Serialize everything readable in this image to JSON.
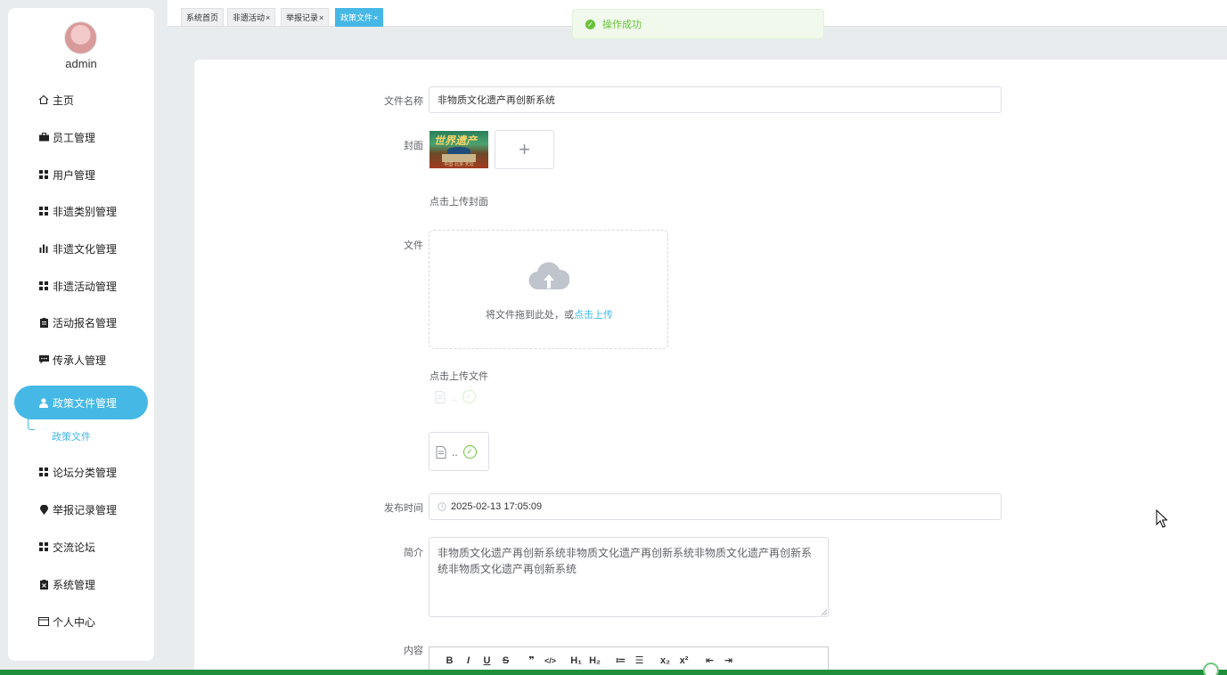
{
  "user": {
    "name": "admin"
  },
  "sidebar": {
    "items": [
      {
        "label": "主页",
        "icon": "home-icon"
      },
      {
        "label": "员工管理",
        "icon": "briefcase-icon"
      },
      {
        "label": "用户管理",
        "icon": "grid-icon"
      },
      {
        "label": "非遗类别管理",
        "icon": "grid-icon"
      },
      {
        "label": "非遗文化管理",
        "icon": "bar-chart-icon"
      },
      {
        "label": "非遗活动管理",
        "icon": "grid-icon"
      },
      {
        "label": "活动报名管理",
        "icon": "clipboard-icon"
      },
      {
        "label": "传承人管理",
        "icon": "message-icon"
      },
      {
        "label": "政策文件管理",
        "icon": "user-icon"
      },
      {
        "label": "论坛分类管理",
        "icon": "grid-icon"
      },
      {
        "label": "举报记录管理",
        "icon": "map-pin-icon"
      },
      {
        "label": "交流论坛",
        "icon": "grid-icon"
      },
      {
        "label": "系统管理",
        "icon": "clipboard-x-icon"
      },
      {
        "label": "个人中心",
        "icon": "card-icon"
      }
    ],
    "active_index": 8,
    "sub_item": "政策文件"
  },
  "tabs": [
    {
      "label": "系统首页",
      "closable": false
    },
    {
      "label": "非遗活动",
      "closable": true
    },
    {
      "label": "举报记录",
      "closable": true
    },
    {
      "label": "政策文件",
      "closable": true,
      "active": true
    }
  ],
  "toast": {
    "message": "操作成功"
  },
  "form": {
    "file_name": {
      "label": "文件名称",
      "value": "非物质文化遗产再创新系统"
    },
    "cover": {
      "label": "封面",
      "thumb_title": "世界遗产",
      "thumb_caption": "中国·北京·天坛",
      "hint": "点击上传封面",
      "add_symbol": "+"
    },
    "file": {
      "label": "文件",
      "drop_text": "将文件拖到此处，或",
      "drop_link": "点击上传",
      "hint": "点击上传文件",
      "file_name_short": ".."
    },
    "publish_time": {
      "label": "发布时间",
      "value": "2025-02-13 17:05:09"
    },
    "intro": {
      "label": "简介",
      "value": "非物质文化遗产再创新系统非物质文化遗产再创新系统非物质文化遗产再创新系统非物质文化遗产再创新系统"
    },
    "content": {
      "label": "内容",
      "toolbar": [
        "B",
        "I",
        "U",
        "S",
        "❞",
        "</>",
        "H₁",
        "H₂",
        "≔",
        "☰",
        "x₂",
        "x²",
        "⇤",
        "⇥"
      ]
    }
  },
  "colors": {
    "accent": "#45b8e6",
    "success": "#67c23a",
    "bottom_bar": "#1e8f3c"
  }
}
